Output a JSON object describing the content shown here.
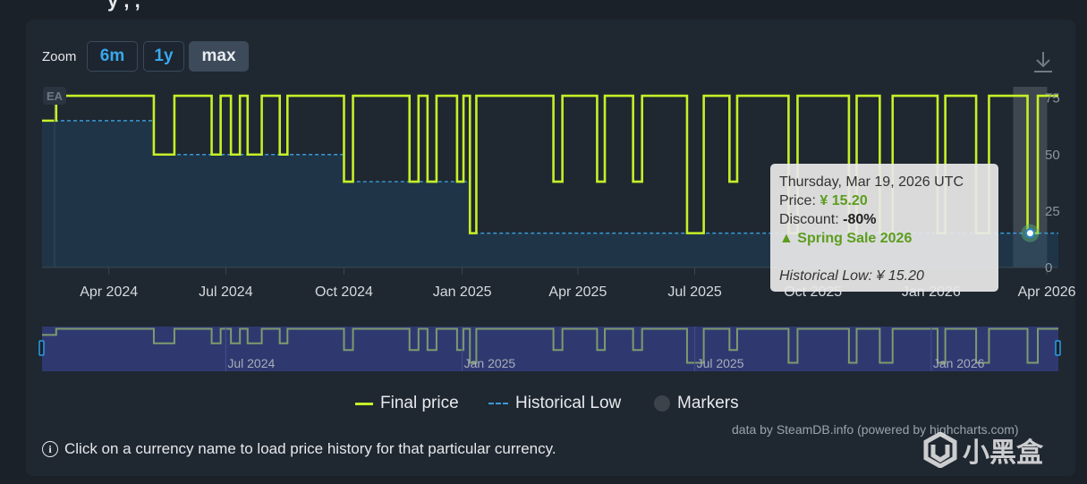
{
  "page": {
    "title_fragment": "y , ,"
  },
  "zoom": {
    "label": "Zoom",
    "buttons": [
      "6m",
      "1y",
      "max"
    ],
    "active": "max"
  },
  "chart_data": {
    "type": "line",
    "xaxis_ticks": [
      "Apr 2024",
      "Jul 2024",
      "Oct 2024",
      "Jan 2025",
      "Apr 2025",
      "Jul 2025",
      "Oct 2025",
      "Jan 2026",
      "Apr 2026"
    ],
    "yaxis_ticks": [
      "75",
      "50",
      "25",
      "0"
    ],
    "ylim": [
      0,
      80
    ],
    "x_range": [
      "2024-02-09",
      "2026-04-10"
    ],
    "series": [
      {
        "name": "Final price",
        "color": "#c6f027",
        "step": true,
        "points": [
          [
            "2024-02-09",
            65
          ],
          [
            "2024-02-20",
            76
          ],
          [
            "2024-05-06",
            50
          ],
          [
            "2024-05-22",
            76
          ],
          [
            "2024-06-20",
            50
          ],
          [
            "2024-06-27",
            76
          ],
          [
            "2024-07-05",
            50
          ],
          [
            "2024-07-12",
            76
          ],
          [
            "2024-07-18",
            50
          ],
          [
            "2024-07-29",
            76
          ],
          [
            "2024-08-12",
            50
          ],
          [
            "2024-08-18",
            76
          ],
          [
            "2024-10-01",
            38
          ],
          [
            "2024-10-08",
            76
          ],
          [
            "2024-11-21",
            38
          ],
          [
            "2024-11-28",
            76
          ],
          [
            "2024-12-05",
            38
          ],
          [
            "2024-12-12",
            76
          ],
          [
            "2024-12-28",
            38
          ],
          [
            "2025-01-02",
            76
          ],
          [
            "2025-01-07",
            15.2
          ],
          [
            "2025-01-12",
            76
          ],
          [
            "2025-03-13",
            38
          ],
          [
            "2025-03-20",
            76
          ],
          [
            "2025-04-16",
            38
          ],
          [
            "2025-04-22",
            76
          ],
          [
            "2025-05-14",
            38
          ],
          [
            "2025-05-21",
            76
          ],
          [
            "2025-06-25",
            15.2
          ],
          [
            "2025-07-08",
            76
          ],
          [
            "2025-07-28",
            38
          ],
          [
            "2025-08-03",
            76
          ],
          [
            "2025-09-12",
            15.2
          ],
          [
            "2025-09-19",
            76
          ],
          [
            "2025-10-29",
            15.2
          ],
          [
            "2025-11-04",
            76
          ],
          [
            "2025-11-22",
            15.2
          ],
          [
            "2025-12-02",
            76
          ],
          [
            "2026-01-06",
            15.2
          ],
          [
            "2026-01-12",
            76
          ],
          [
            "2026-02-05",
            15.2
          ],
          [
            "2026-02-15",
            76
          ],
          [
            "2026-03-17",
            15.2
          ],
          [
            "2026-03-25",
            76
          ],
          [
            "2026-04-10",
            76
          ]
        ]
      },
      {
        "name": "Historical Low",
        "color": "#3a9ad6",
        "dashed": true,
        "step": true,
        "points": [
          [
            "2024-02-09",
            65
          ],
          [
            "2024-05-06",
            50
          ],
          [
            "2024-10-01",
            38
          ],
          [
            "2025-01-07",
            15.2
          ],
          [
            "2026-04-10",
            15.2
          ]
        ]
      }
    ],
    "navigator_ticks": [
      "Jul 2024",
      "Jan 2025",
      "Jul 2025",
      "Jan 2026"
    ],
    "legend": [
      "Final price",
      "Historical Low",
      "Markers"
    ],
    "legend_placement": "bottom",
    "badge": "EA",
    "highlight_date": "2026-03-19"
  },
  "tooltip": {
    "date": "Thursday, Mar 19, 2026 UTC",
    "price_label": "Price: ",
    "price_value": "¥ 15.20",
    "discount_label": "Discount: ",
    "discount_value": "-80%",
    "event": "▲ Spring Sale 2026",
    "historical_low": "Historical Low: ¥ 15.20"
  },
  "credit": "data by SteamDB.info (powered by highcharts.com)",
  "info_text": "Click on a currency name to load price history for that particular currency.",
  "watermark": "小黑盒"
}
